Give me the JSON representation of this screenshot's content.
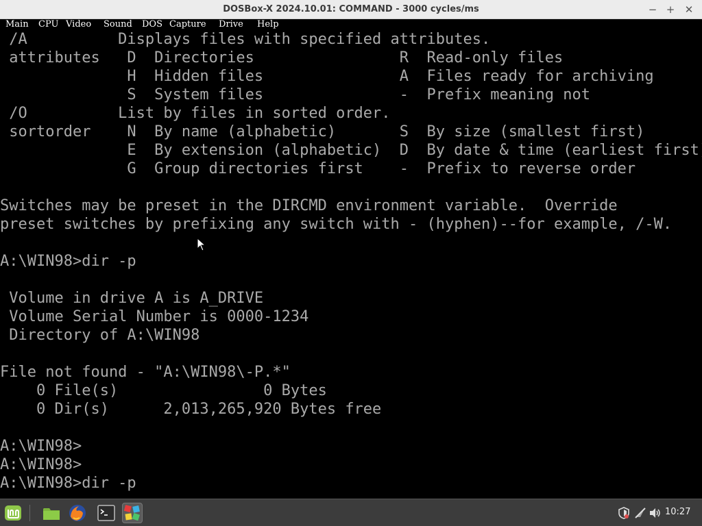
{
  "window": {
    "title": "DOSBox-X 2024.10.01: COMMAND - 3000 cycles/ms",
    "minimize_glyph": "−",
    "maximize_glyph": "+",
    "close_glyph": "✕"
  },
  "menu": {
    "items": [
      "Main",
      "CPU",
      "Video",
      "Sound",
      "DOS",
      "Capture",
      "Drive",
      "Help"
    ]
  },
  "screen": {
    "lines": [
      " /A          Displays files with specified attributes.",
      " attributes   D  Directories                R  Read-only files",
      "              H  Hidden files               A  Files ready for archiving",
      "              S  System files               -  Prefix meaning not",
      " /O          List by files in sorted order.",
      " sortorder    N  By name (alphabetic)       S  By size (smallest first)",
      "              E  By extension (alphabetic)  D  By date & time (earliest first)",
      "              G  Group directories first    -  Prefix to reverse order",
      "",
      "Switches may be preset in the DIRCMD environment variable.  Override",
      "preset switches by prefixing any switch with - (hyphen)--for example, /-W.",
      "",
      "A:\\WIN98>dir -p",
      "",
      " Volume in drive A is A_DRIVE",
      " Volume Serial Number is 0000-1234",
      " Directory of A:\\WIN98",
      "",
      "File not found - \"A:\\WIN98\\-P.*\"",
      "    0 File(s)                0 Bytes",
      "    0 Dir(s)      2,013,265,920 Bytes free",
      "",
      "A:\\WIN98>",
      "A:\\WIN98>",
      "A:\\WIN98>dir -p"
    ]
  },
  "taskbar": {
    "apps": [
      {
        "name": "mint-menu-icon",
        "active": false
      },
      {
        "name": "files-folder-icon",
        "active": false
      },
      {
        "name": "firefox-icon",
        "active": false
      },
      {
        "name": "terminal-icon",
        "active": false
      },
      {
        "name": "dosbox-icon",
        "active": true
      }
    ],
    "clock": "10:27",
    "tray_icons": [
      "shield-icon",
      "network-icon",
      "volume-icon"
    ]
  },
  "colors": {
    "dos_text": "#aaaaaa",
    "dos_bg": "#000000",
    "titlebar_bg": "#ececec",
    "taskbar_bg": "#3c3c3c"
  }
}
